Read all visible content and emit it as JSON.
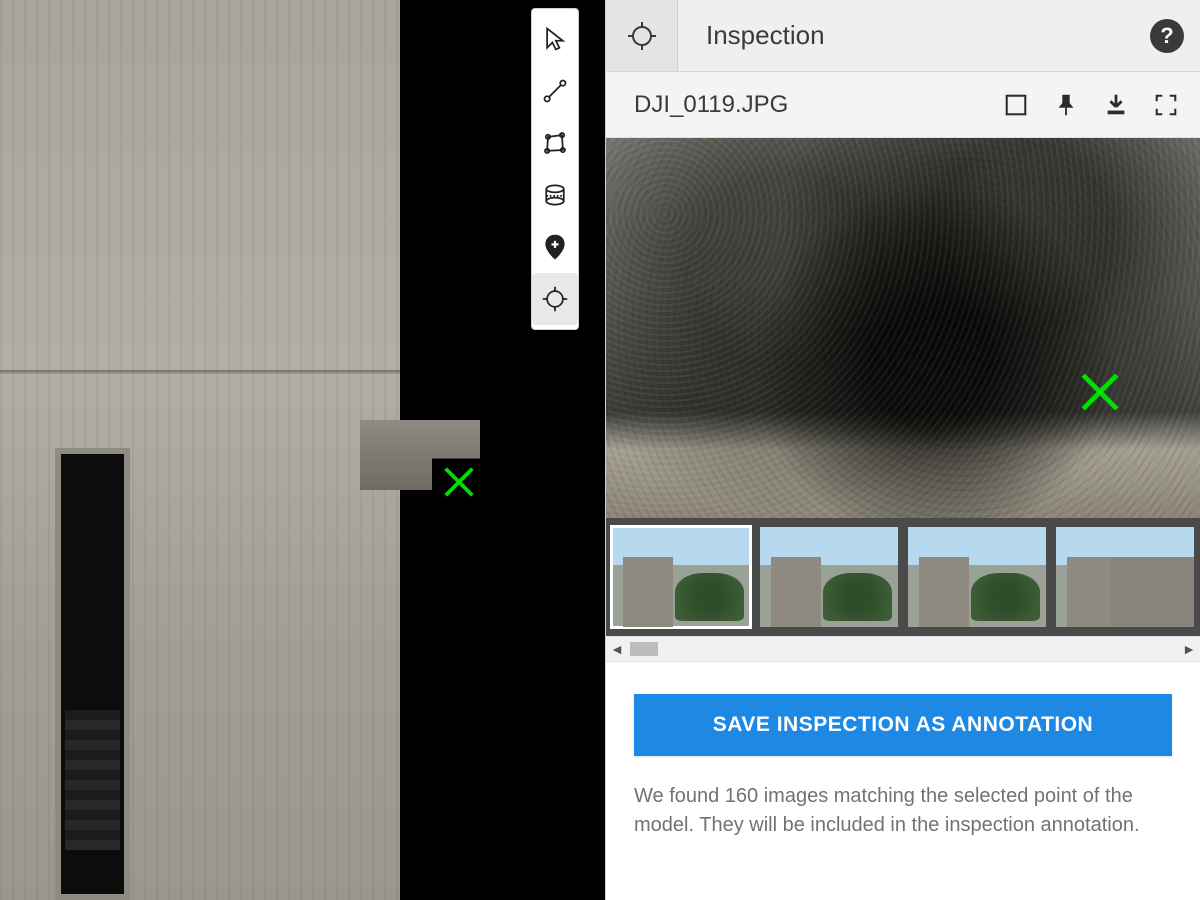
{
  "toolbar": {
    "tools": [
      {
        "name": "select-tool",
        "icon": "cursor-icon",
        "active": false
      },
      {
        "name": "line-tool",
        "icon": "line-icon",
        "active": false
      },
      {
        "name": "polygon-tool",
        "icon": "polygon-icon",
        "active": false
      },
      {
        "name": "volume-tool",
        "icon": "cylinder-icon",
        "active": false
      },
      {
        "name": "marker-tool",
        "icon": "pin-plus-icon",
        "active": false
      },
      {
        "name": "inspection-tool",
        "icon": "crosshair-icon",
        "active": true
      }
    ]
  },
  "panel": {
    "title": "Inspection",
    "help_label": "?",
    "image": {
      "filename": "DJI_0119.JPG",
      "actions": {
        "compare": "compare-icon",
        "pin": "pin-icon",
        "download": "download-icon",
        "fullscreen": "fullscreen-icon"
      }
    },
    "thumbnails": {
      "selected_index": 0,
      "count_visible": 4
    },
    "save_button_label": "SAVE INSPECTION AS ANNOTATION",
    "match_count": 160,
    "info_text": "We found 160 images matching the selected point of the model. They will be included in the inspection annotation."
  },
  "marker": {
    "color": "#00e000"
  }
}
